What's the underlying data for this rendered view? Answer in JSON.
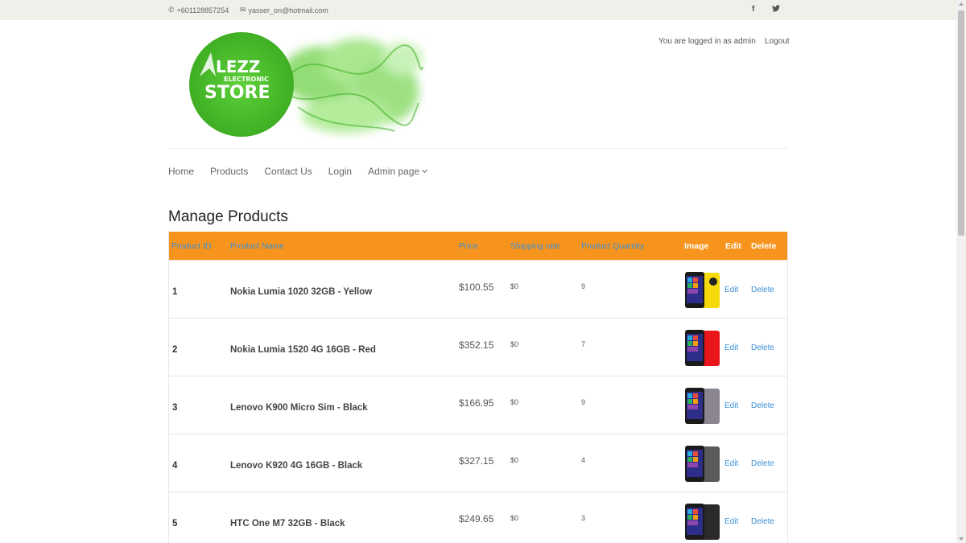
{
  "topbar": {
    "phone": "+601128857254",
    "email": "yasser_on@hotmail.com",
    "social": [
      "f",
      "t"
    ]
  },
  "logo": {
    "line1": "LEZZ",
    "line2": "ELECTRONIC",
    "line3": "STORE",
    "color": "#4cbf2e"
  },
  "auth": {
    "status": "You are logged in as admin",
    "logout": "Logout"
  },
  "nav": {
    "items": [
      "Home",
      "Products",
      "Contact Us",
      "Login",
      "Admin page"
    ]
  },
  "page": {
    "title": "Manage Products"
  },
  "table": {
    "header_color": "#f7941d",
    "link_color": "#3b8fd6",
    "headers": {
      "id": "Product ID",
      "name": "Product Name",
      "price": "Price",
      "shipping": "Shipping rate",
      "quantity": "Product Quantity",
      "image": "Image",
      "edit": "Edit",
      "delete": "Delete"
    },
    "rows": [
      {
        "id": "1",
        "name": "Nokia Lumia 1020 32GB - Yellow",
        "price": "$100.55",
        "shipping": "$0",
        "quantity": "9",
        "edit": "Edit",
        "delete": "Delete",
        "image": "yellow-phone",
        "color": "#f5d90a"
      },
      {
        "id": "2",
        "name": "Nokia Lumia 1520 4G 16GB - Red",
        "price": "$352.15",
        "shipping": "$0",
        "quantity": "7",
        "edit": "Edit",
        "delete": "Delete",
        "image": "red-phone",
        "color": "#e8161b"
      },
      {
        "id": "3",
        "name": "Lenovo K900 Micro Sim - Black",
        "price": "$166.95",
        "shipping": "$0",
        "quantity": "9",
        "edit": "Edit",
        "delete": "Delete",
        "image": "grey-phone",
        "color": "#8a8590"
      },
      {
        "id": "4",
        "name": "Lenovo K920 4G 16GB - Black",
        "price": "$327.15",
        "shipping": "$0",
        "quantity": "4",
        "edit": "Edit",
        "delete": "Delete",
        "image": "dark-phone",
        "color": "#5a5a5a"
      },
      {
        "id": "5",
        "name": "HTC One M7 32GB - Black",
        "price": "$249.65",
        "shipping": "$0",
        "quantity": "3",
        "edit": "Edit",
        "delete": "Delete",
        "image": "black-phone",
        "color": "#2a2a2a"
      }
    ]
  }
}
